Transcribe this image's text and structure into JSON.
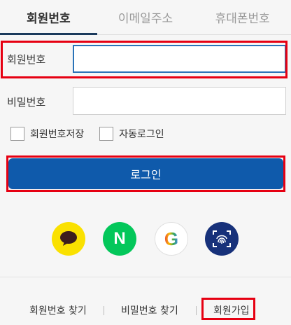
{
  "tabs": [
    {
      "label": "회원번호",
      "active": true
    },
    {
      "label": "이메일주소",
      "active": false
    },
    {
      "label": "휴대폰번호",
      "active": false
    }
  ],
  "form": {
    "member_label": "회원번호",
    "member_value": "",
    "password_label": "비밀번호",
    "password_value": ""
  },
  "options": {
    "save_id_label": "회원번호저장",
    "auto_login_label": "자동로그인"
  },
  "login_button": "로그인",
  "social": [
    {
      "name": "kakao-icon",
      "color": "#fae100"
    },
    {
      "name": "naver-icon",
      "label": "N",
      "color": "#03c75a"
    },
    {
      "name": "google-icon",
      "label": "G",
      "color": "#ffffff"
    },
    {
      "name": "biometric-icon",
      "color": "#17317a"
    }
  ],
  "footer_links": {
    "find_member": "회원번호 찾기",
    "find_password": "비밀번호 찾기",
    "signup": "회원가입"
  },
  "colors": {
    "accent": "#0f5aab",
    "tab_underline": "#1b3a5c",
    "highlight": "#e60012"
  }
}
